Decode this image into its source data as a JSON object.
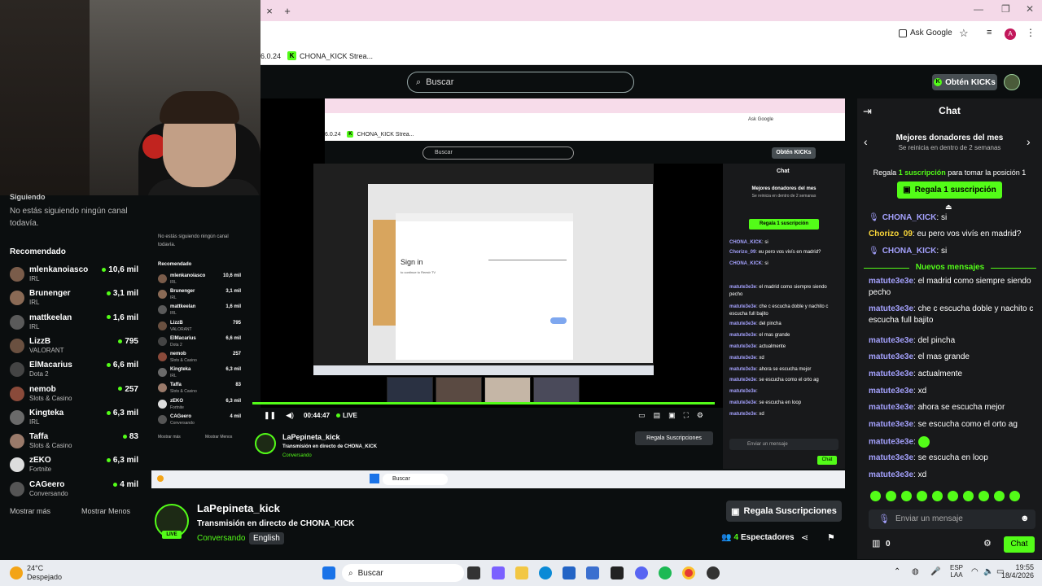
{
  "browser": {
    "ask_google": "Ask Google",
    "zoom": "6.0.24",
    "bookmark_label": "CHONA_KICK Strea...",
    "new_tab": "+",
    "close_tab": "×",
    "win_min": "—",
    "win_max": "❐",
    "win_close": "✕"
  },
  "site": {
    "search_placeholder": "Buscar",
    "get_kicks": "Obtén KICKs"
  },
  "sidebar": {
    "following_header": "Siguiendo",
    "no_following": "No estás siguiendo ningún canal todavía.",
    "recommended_header": "Recomendado",
    "items": [
      {
        "name": "mlenkanoiasco",
        "category": "IRL",
        "count": "10,6 mil"
      },
      {
        "name": "Brunenger",
        "category": "IRL",
        "count": "3,1 mil"
      },
      {
        "name": "mattkeelan",
        "category": "IRL",
        "count": "1,6 mil"
      },
      {
        "name": "LizzB",
        "category": "VALORANT",
        "count": "795"
      },
      {
        "name": "ElMacarius",
        "category": "Dota 2",
        "count": "6,6 mil"
      },
      {
        "name": "nemob",
        "category": "Slots & Casino",
        "count": "257"
      },
      {
        "name": "Kingteka",
        "category": "IRL",
        "count": "6,3 mil"
      },
      {
        "name": "Taffa",
        "category": "Slots & Casino",
        "count": "83"
      },
      {
        "name": "zEKO",
        "category": "Fortnite",
        "count": "6,3 mil"
      },
      {
        "name": "CAGeero",
        "category": "Conversando",
        "count": "4 mil"
      }
    ],
    "show_more": "Mostrar más",
    "show_less": "Mostrar Menos"
  },
  "player": {
    "time": "00:44:47",
    "live": "LIVE",
    "sign_in_title": "Sign in",
    "sign_in_sub": "to continue to Reestr TV"
  },
  "stream": {
    "channel": "LaPepineta_kick",
    "title": "Transmisión en directo de CHONA_KICK",
    "category": "Conversando",
    "language": "English",
    "live_badge": "LIVE",
    "gift_subs": "Regala Suscripciones",
    "viewers_count": "4",
    "viewers_label": "Espectadores"
  },
  "chat": {
    "title": "Chat",
    "top_donors": "Mejores donadores del mes",
    "reset_text": "Se reinicia en dentro de 2 semanas",
    "gift_prompt_a": "Regala",
    "gift_prompt_b": "1 suscripción",
    "gift_prompt_c": "para tomar la posición 1",
    "gift_button": "Regala 1 suscripción",
    "new_messages": "Nuevos mensajes",
    "input_placeholder": "Enviar un mensaje",
    "kicks_count": "0",
    "chat_button": "Chat",
    "messages": [
      {
        "user": "CHONA_KICK",
        "text": "si",
        "style": "un2"
      },
      {
        "user": "Chorizo_09",
        "text": "eu pero vos vivís en madrid?",
        "style": "un3"
      },
      {
        "user": "CHONA_KICK",
        "text": "si",
        "style": "un2"
      },
      {
        "user": "matute3e3e",
        "text": "el madrid como siempre siendo pecho",
        "style": "un2"
      },
      {
        "user": "matute3e3e",
        "text": "che c escucha doble y nachito c escucha full bajito",
        "style": "un2"
      },
      {
        "user": "matute3e3e",
        "text": "del pincha",
        "style": "un2"
      },
      {
        "user": "matute3e3e",
        "text": "el mas grande",
        "style": "un2"
      },
      {
        "user": "matute3e3e",
        "text": "actualmente",
        "style": "un2"
      },
      {
        "user": "matute3e3e",
        "text": "xd",
        "style": "un2"
      },
      {
        "user": "matute3e3e",
        "text": "ahora se escucha mejor",
        "style": "un2"
      },
      {
        "user": "matute3e3e",
        "text": "se escucha como el orto ag",
        "style": "un2"
      },
      {
        "user": "matute3e3e",
        "text": "",
        "style": "un2"
      },
      {
        "user": "matute3e3e",
        "text": "se escucha en loop",
        "style": "un2"
      },
      {
        "user": "matute3e3e",
        "text": "xd",
        "style": "un2"
      }
    ]
  },
  "taskbar": {
    "temp": "24°C",
    "weather": "Despejado",
    "search": "Buscar",
    "lang1": "ESP",
    "lang2": "LAA",
    "time": "19:55",
    "date": "18/4/2026"
  },
  "colors": {
    "accent": "#53fc18",
    "bg": "#0b0e0f",
    "chat_bg": "#18191b"
  }
}
